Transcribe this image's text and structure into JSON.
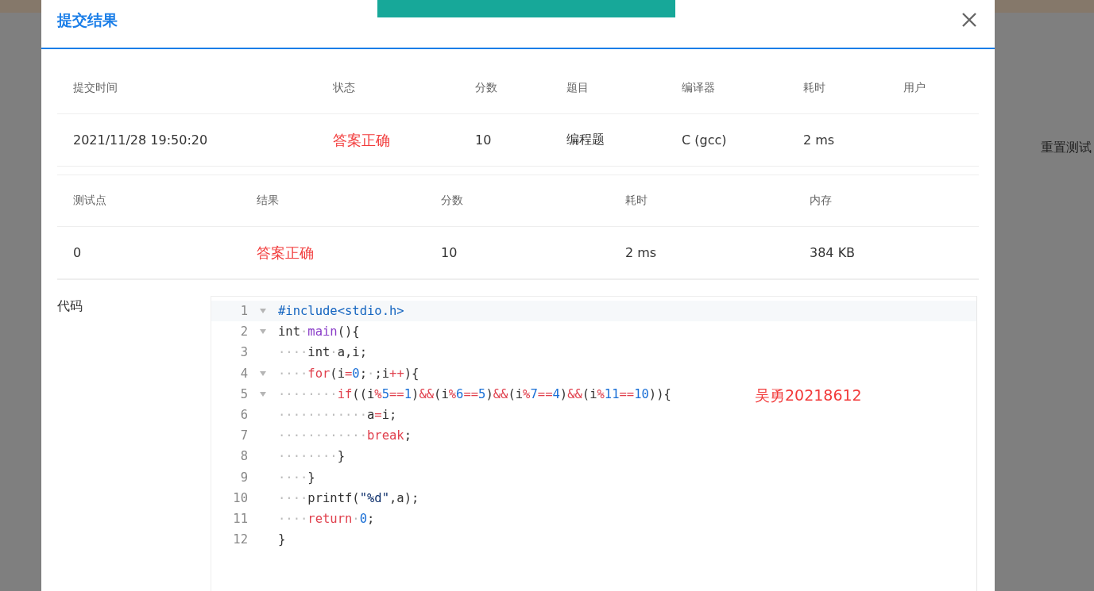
{
  "background": {
    "button": "重置测试"
  },
  "toast": {
    "kind": "success"
  },
  "dialog": {
    "title": "提交结果",
    "submission": {
      "columns": [
        "提交时间",
        "状态",
        "分数",
        "题目",
        "编译器",
        "耗时",
        "用户"
      ],
      "rows": [
        {
          "cells": [
            "2021/11/28 19:50:20",
            "答案正确",
            "10",
            "编程题",
            "C (gcc)",
            "2 ms",
            ""
          ]
        }
      ]
    },
    "testcases": {
      "columns": [
        "测试点",
        "结果",
        "分数",
        "耗时",
        "内存"
      ],
      "rows": [
        {
          "cells": [
            "0",
            "答案正确",
            "10",
            "2 ms",
            "384 KB"
          ]
        }
      ]
    },
    "code_label": "代码",
    "code": [
      {
        "number": "1",
        "foldable": true,
        "active": true,
        "tokens": [
          {
            "kind": "pre",
            "text": "#include<stdio.h>"
          }
        ]
      },
      {
        "number": "2",
        "foldable": true,
        "active": false,
        "tokens": [
          {
            "kind": "txt",
            "text": "int"
          },
          {
            "kind": "ws",
            "text": "·"
          },
          {
            "kind": "fn",
            "text": "main"
          },
          {
            "kind": "txt",
            "text": "(){"
          }
        ]
      },
      {
        "number": "3",
        "foldable": false,
        "active": false,
        "tokens": [
          {
            "kind": "ws",
            "text": "····"
          },
          {
            "kind": "txt",
            "text": "int"
          },
          {
            "kind": "ws",
            "text": "·"
          },
          {
            "kind": "txt",
            "text": "a,i;"
          }
        ]
      },
      {
        "number": "4",
        "foldable": true,
        "active": false,
        "tokens": [
          {
            "kind": "ws",
            "text": "····"
          },
          {
            "kind": "kw",
            "text": "for"
          },
          {
            "kind": "txt",
            "text": "(i"
          },
          {
            "kind": "op",
            "text": "="
          },
          {
            "kind": "num",
            "text": "0"
          },
          {
            "kind": "txt",
            "text": ";"
          },
          {
            "kind": "ws",
            "text": "·"
          },
          {
            "kind": "txt",
            "text": ";i"
          },
          {
            "kind": "op",
            "text": "++"
          },
          {
            "kind": "txt",
            "text": "){"
          }
        ]
      },
      {
        "number": "5",
        "foldable": true,
        "active": false,
        "tokens": [
          {
            "kind": "ws",
            "text": "········"
          },
          {
            "kind": "kw",
            "text": "if"
          },
          {
            "kind": "txt",
            "text": "((i"
          },
          {
            "kind": "op",
            "text": "%"
          },
          {
            "kind": "num",
            "text": "5"
          },
          {
            "kind": "op",
            "text": "=="
          },
          {
            "kind": "num",
            "text": "1"
          },
          {
            "kind": "txt",
            "text": ")"
          },
          {
            "kind": "op",
            "text": "&&"
          },
          {
            "kind": "txt",
            "text": "(i"
          },
          {
            "kind": "op",
            "text": "%"
          },
          {
            "kind": "num",
            "text": "6"
          },
          {
            "kind": "op",
            "text": "=="
          },
          {
            "kind": "num",
            "text": "5"
          },
          {
            "kind": "txt",
            "text": ")"
          },
          {
            "kind": "op",
            "text": "&&"
          },
          {
            "kind": "txt",
            "text": "(i"
          },
          {
            "kind": "op",
            "text": "%"
          },
          {
            "kind": "num",
            "text": "7"
          },
          {
            "kind": "op",
            "text": "=="
          },
          {
            "kind": "num",
            "text": "4"
          },
          {
            "kind": "txt",
            "text": ")"
          },
          {
            "kind": "op",
            "text": "&&"
          },
          {
            "kind": "txt",
            "text": "(i"
          },
          {
            "kind": "op",
            "text": "%"
          },
          {
            "kind": "num",
            "text": "11"
          },
          {
            "kind": "op",
            "text": "=="
          },
          {
            "kind": "num",
            "text": "10"
          },
          {
            "kind": "txt",
            "text": ")){"
          }
        ]
      },
      {
        "number": "6",
        "foldable": false,
        "active": false,
        "tokens": [
          {
            "kind": "ws",
            "text": "············"
          },
          {
            "kind": "txt",
            "text": "a"
          },
          {
            "kind": "op",
            "text": "="
          },
          {
            "kind": "txt",
            "text": "i;"
          }
        ]
      },
      {
        "number": "7",
        "foldable": false,
        "active": false,
        "tokens": [
          {
            "kind": "ws",
            "text": "············"
          },
          {
            "kind": "kw",
            "text": "break"
          },
          {
            "kind": "txt",
            "text": ";"
          }
        ]
      },
      {
        "number": "8",
        "foldable": false,
        "active": false,
        "tokens": [
          {
            "kind": "ws",
            "text": "········"
          },
          {
            "kind": "txt",
            "text": "}"
          }
        ]
      },
      {
        "number": "9",
        "foldable": false,
        "active": false,
        "tokens": [
          {
            "kind": "ws",
            "text": "····"
          },
          {
            "kind": "txt",
            "text": "}"
          }
        ]
      },
      {
        "number": "10",
        "foldable": false,
        "active": false,
        "tokens": [
          {
            "kind": "ws",
            "text": "····"
          },
          {
            "kind": "txt",
            "text": "printf("
          },
          {
            "kind": "str",
            "text": "\"%d\""
          },
          {
            "kind": "txt",
            "text": ",a);"
          }
        ]
      },
      {
        "number": "11",
        "foldable": false,
        "active": false,
        "tokens": [
          {
            "kind": "ws",
            "text": "····"
          },
          {
            "kind": "kw",
            "text": "return"
          },
          {
            "kind": "ws",
            "text": "·"
          },
          {
            "kind": "num",
            "text": "0"
          },
          {
            "kind": "txt",
            "text": ";"
          }
        ]
      },
      {
        "number": "12",
        "foldable": false,
        "active": false,
        "tokens": [
          {
            "kind": "txt",
            "text": "}"
          }
        ]
      }
    ],
    "annotation": "吴勇20218612"
  }
}
